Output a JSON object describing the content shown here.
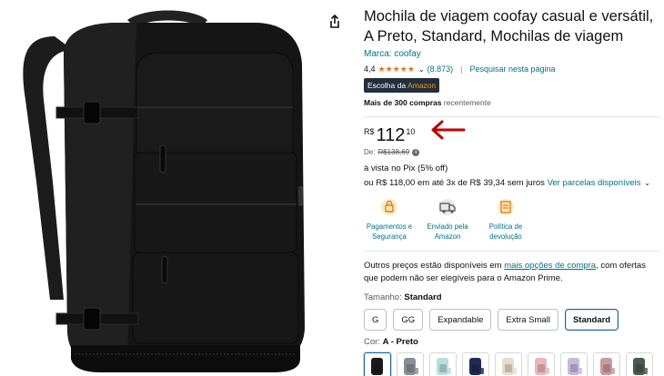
{
  "product": {
    "title": "Mochila de viagem coofay casual e versátil, A Preto, Standard, Mochilas de viagem",
    "brand": "Marca: coofay",
    "rating": "4,4",
    "rating_count": "(8.873)",
    "search_page": "Pesquisar nesta página",
    "badge_prefix": "Escolha da ",
    "badge_accent": "Amazon",
    "bought_bold": "Mais de 300 compras",
    "bought_rest": " recentemente"
  },
  "price": {
    "currency": "R$",
    "whole": "112",
    "fraction": "10",
    "list_label": "De:",
    "list_price": "R$138,69",
    "pix": "à vista no Pix (5% off)",
    "installments_text": "ou R$ 118,00 em até 3x de R$ 39,34 sem juros",
    "installments_link": "Ver parcelas disponíveis"
  },
  "features": [
    {
      "icon": "secure-payment-icon",
      "label": "Pagamentos e Segurança"
    },
    {
      "icon": "shipping-truck-icon",
      "label": "Enviado pela Amazon"
    },
    {
      "icon": "return-policy-icon",
      "label": "Política de devolução"
    }
  ],
  "offers": {
    "prefix": "Outros preços estão disponíveis em ",
    "link": "mais opções de compra",
    "suffix": ", com ofertas que podem não ser elegíveis para o Amazon Prime."
  },
  "size": {
    "label": "Tamanho: ",
    "selected": "Standard",
    "options": [
      "G",
      "GG",
      "Expandable",
      "Extra Small",
      "Standard"
    ]
  },
  "color": {
    "label": "Cor: ",
    "selected": "A - Preto",
    "swatch_colors": [
      "#1a1a1a",
      "#8a8d94",
      "#b9dde0",
      "#1f2a55",
      "#e8dccb",
      "#e8b7b9",
      "#c7b9dd",
      "#c99aa0",
      "#4a5a4e"
    ]
  },
  "colors": {
    "link": "#007185",
    "star": "#de7921",
    "badge_bg": "#232f3e",
    "arrow": "#c00000",
    "selected_border": "#2162a1"
  }
}
